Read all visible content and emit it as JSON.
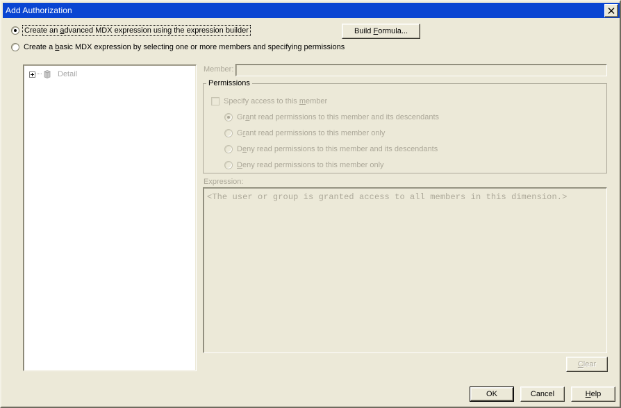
{
  "window": {
    "title": "Add Authorization",
    "close_label": "Close",
    "close_icon": "close-x-icon"
  },
  "mode_options": [
    {
      "id": "advanced",
      "pre": "Create an ",
      "accel": "a",
      "post": "dvanced MDX expression using the expression builder",
      "selected": true,
      "focused": true
    },
    {
      "id": "basic",
      "pre": "Create a ",
      "accel": "b",
      "post": "asic MDX expression by selecting one or more members and specifying permissions",
      "selected": false,
      "focused": false
    }
  ],
  "build_formula": {
    "pre": "Build ",
    "accel": "F",
    "post": "ormula...",
    "enabled": true
  },
  "tree": {
    "items": [
      {
        "label": "Detail",
        "expander": "plus-icon",
        "icon": "cube-icon",
        "disabled": true
      }
    ]
  },
  "member": {
    "label": "Member:",
    "value": "",
    "enabled": false
  },
  "permissions": {
    "legend": "Permissions",
    "specify_checkbox": {
      "pre": "Specify access to this ",
      "accel": "m",
      "post": "ember",
      "checked": false,
      "enabled": false
    },
    "options": [
      {
        "id": "grant-descendants",
        "pre": "Gr",
        "accel": "a",
        "post": "nt read permissions to this member and its descendants",
        "selected": true,
        "enabled": false
      },
      {
        "id": "grant-only",
        "pre": "G",
        "accel": "r",
        "post": "ant read permissions to this member only",
        "selected": false,
        "enabled": false
      },
      {
        "id": "deny-descendants",
        "pre": "D",
        "accel": "e",
        "post": "ny read permissions to this member and its descendants",
        "selected": false,
        "enabled": false
      },
      {
        "id": "deny-only",
        "pre": "",
        "accel": "D",
        "post": "eny read permissions to this member only",
        "selected": false,
        "enabled": false
      }
    ]
  },
  "expression": {
    "label": "Expression:",
    "text": "<The user or group is granted access to all members in this dimension.>",
    "enabled": false
  },
  "buttons": {
    "clear": {
      "pre": "",
      "accel": "C",
      "post": "lear",
      "enabled": false
    },
    "ok": {
      "label": "OK",
      "enabled": true,
      "default": true
    },
    "cancel": {
      "label": "Cancel",
      "enabled": true
    },
    "help": {
      "pre": "",
      "accel": "H",
      "post": "elp",
      "enabled": true
    }
  },
  "colors": {
    "title_bar": "#0A45D2",
    "dialog_face": "#ECE9D8",
    "disabled_text": "#ACA899",
    "tree_background": "#FFFFFF"
  }
}
